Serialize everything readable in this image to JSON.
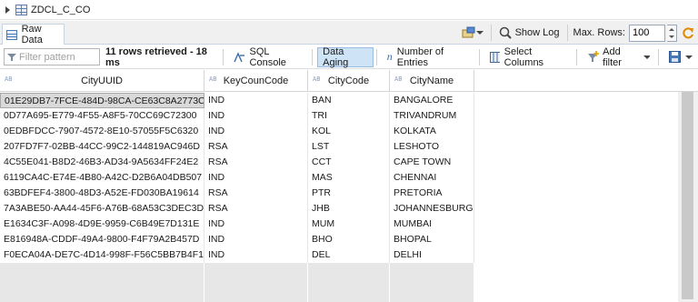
{
  "breadcrumb": {
    "name": "ZDCL_C_CO"
  },
  "tab": {
    "label": "Raw Data"
  },
  "right_tools": {
    "show_log": "Show Log",
    "max_rows_label": "Max. Rows:",
    "max_rows_value": "100"
  },
  "toolbar": {
    "filter_placeholder": "Filter pattern",
    "status": "11 rows retrieved - 18 ms",
    "sql_console": "SQL Console",
    "data_aging": "Data Aging",
    "number_of_entries": "Number of Entries",
    "select_columns": "Select Columns",
    "add_filter": "Add filter"
  },
  "grid": {
    "type_tag": "AB",
    "columns": [
      "CityUUID",
      "KeyCounCode",
      "CityCode",
      "CityName"
    ],
    "rows": [
      [
        "01E29DB7-7FCE-484D-98CA-CE63C8A2773C",
        "IND",
        "BAN",
        "BANGALORE"
      ],
      [
        "0D77A695-E779-4F55-A8F5-70CC69C72300",
        "IND",
        "TRI",
        "TRIVANDRUM"
      ],
      [
        "0EDBFDCC-7907-4572-8E10-57055F5C6320",
        "IND",
        "KOL",
        "KOLKATA"
      ],
      [
        "207FD7F7-02BB-44CC-99C2-144819AC946D",
        "RSA",
        "LST",
        "LESHOTO"
      ],
      [
        "4C55E041-B8D2-46B3-AD34-9A5634FF24E2",
        "RSA",
        "CCT",
        "CAPE TOWN"
      ],
      [
        "6119CA4C-E74E-4B80-A42C-D2B6A04DB507",
        "IND",
        "MAS",
        "CHENNAI"
      ],
      [
        "63BDFEF4-3800-48D3-A52E-FD030BA19614",
        "RSA",
        "PTR",
        "PRETORIA"
      ],
      [
        "7A3ABE50-AA44-45F6-A76B-68A53C3DEC3D",
        "RSA",
        "JHB",
        "JOHANNESBURG"
      ],
      [
        "E1634C3F-A098-4D9E-9959-C6B49E7D131E",
        "IND",
        "MUM",
        "MUMBAI"
      ],
      [
        "E816948A-CDDF-49A4-9800-F4F79A2B457D",
        "IND",
        "BHO",
        "BHOPAL"
      ],
      [
        "F0ECA04A-DE7C-4D14-998F-F56C5BB7B4F1",
        "IND",
        "DEL",
        "DELHI"
      ]
    ]
  }
}
